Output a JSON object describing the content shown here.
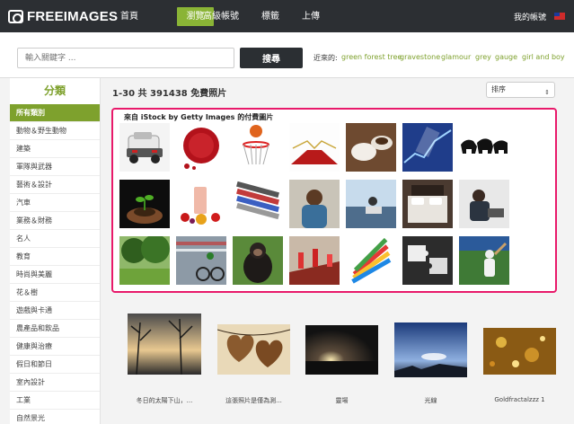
{
  "nav": {
    "brand": "FREEIMAGES",
    "items": [
      "首頁",
      "瀏覽",
      "高級帳號",
      "標籤",
      "上傳"
    ],
    "active_index": 1,
    "account": "我的帳號",
    "flag_icon": "taiwan-flag-icon"
  },
  "search": {
    "placeholder": "輸入關鍵字 ...",
    "button_label": "搜尋",
    "recent_label": "近來的:",
    "recent_tags": [
      "green forest tree",
      "gravestone",
      "glamour",
      "grey",
      "gauge",
      "girl and boy"
    ]
  },
  "sidebar": {
    "title": "分類",
    "items": [
      "所有類別",
      "動物＆野生動物",
      "建築",
      "軍隊與武器",
      "藝術＆設計",
      "汽車",
      "業務＆財務",
      "名人",
      "教育",
      "時尚與美麗",
      "花＆樹",
      "遊戲與卡通",
      "農產品和飲品",
      "健康與治療",
      "假日和節日",
      "室內設計",
      "工業",
      "自然景光"
    ],
    "active_index": 0
  },
  "main": {
    "result_count": "1-30 共 391438 免費照片",
    "sort_label": "排序",
    "istock_label": "來自 iStock by Getty Images 的付費圖片",
    "istock_images": [
      "toy-cars-image",
      "wax-seal-image",
      "basketball-hoop-image",
      "red-carpet-image",
      "coffee-cups-image",
      "stock-chart-image",
      "bear-silhouettes-image",
      "plant-in-hands-image",
      "smoothie-fruit-image",
      "magazines-image",
      "stressed-man-image",
      "laptop-beach-image",
      "hotel-bed-image",
      "man-on-laptop-image",
      "park-trees-image",
      "cyclist-motion-image",
      "chimpanzee-image",
      "chess-pieces-image",
      "colored-pencils-image",
      "puzzle-hands-image",
      "baseball-batter-image"
    ],
    "photos": [
      {
        "caption": "冬日的太陽下山，...",
        "image": "winter-sunset-trees-image"
      },
      {
        "caption": "這張照片是僅為測...",
        "image": "wooden-hearts-image"
      },
      {
        "caption": "靈場",
        "image": "dark-sunset-field-image"
      },
      {
        "caption": "光線",
        "image": "sky-light-rays-image"
      },
      {
        "caption": "Goldfractalzzz 1",
        "image": "gold-fractal-image"
      }
    ]
  }
}
